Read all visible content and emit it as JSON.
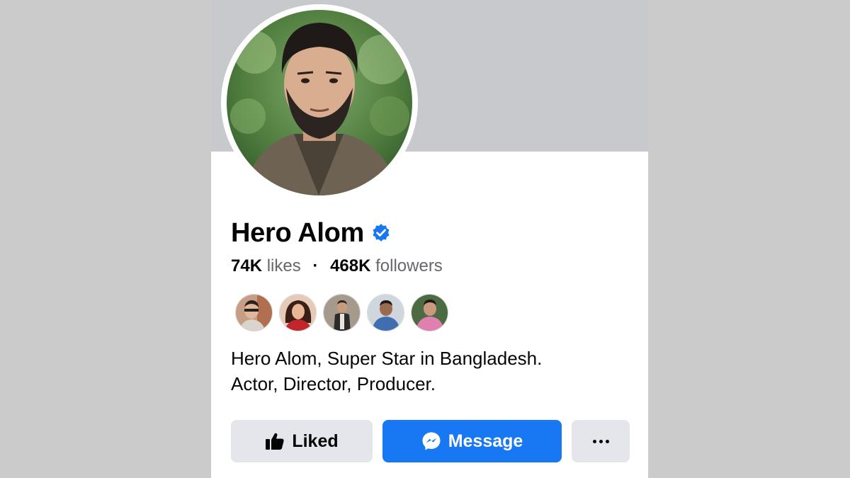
{
  "profile": {
    "name": "Hero Alom",
    "verified": true,
    "likes_count": "74K",
    "likes_label": "likes",
    "separator": "·",
    "followers_count": "468K",
    "followers_label": "followers",
    "bio_line1": "Hero Alom, Super Star in Bangladesh.",
    "bio_line2": "Actor, Director, Producer."
  },
  "friends_preview": [
    {
      "icon": "friend-avatar-1"
    },
    {
      "icon": "friend-avatar-2"
    },
    {
      "icon": "friend-avatar-3"
    },
    {
      "icon": "friend-avatar-4"
    },
    {
      "icon": "friend-avatar-5"
    }
  ],
  "actions": {
    "liked_label": "Liked",
    "liked_icon": "thumbs-up-icon",
    "message_label": "Message",
    "message_icon": "messenger-icon",
    "more_icon": "more-options-icon"
  },
  "colors": {
    "accent": "#1877f2",
    "verified": "#1877f2",
    "secondary_button": "#e4e6eb",
    "cover": "#c7c9cc"
  }
}
